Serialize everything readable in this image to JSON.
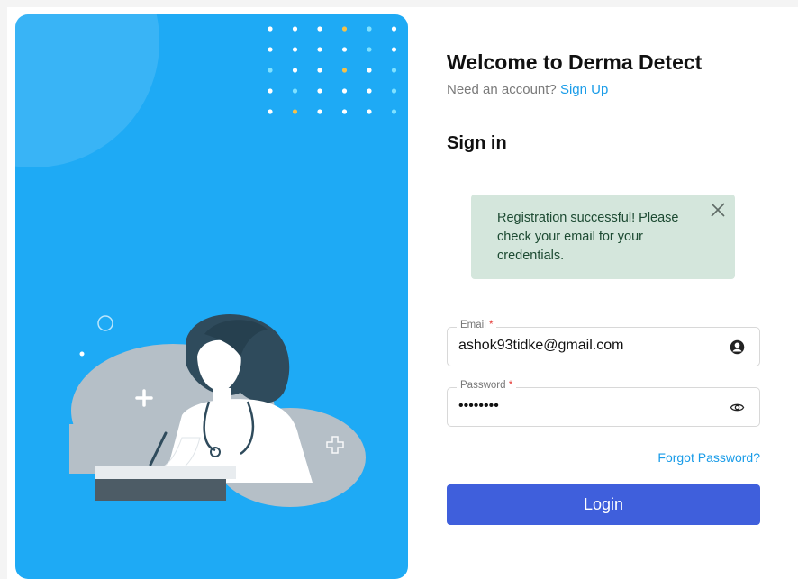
{
  "header": {
    "title": "Welcome to Derma Detect",
    "subtitle_prefix": "Need an account?",
    "signup_link": "Sign Up"
  },
  "form": {
    "heading": "Sign in",
    "email": {
      "label": "Email",
      "required_mark": "*",
      "value": "ashok93tidke@gmail.com",
      "icon": "account-circle-icon"
    },
    "password": {
      "label": "Password",
      "required_mark": "*",
      "value": "••••••••",
      "icon": "eye-icon"
    },
    "forgot_link": "Forgot Password?",
    "login_button": "Login"
  },
  "alert": {
    "message": "Registration successful! Please check your email for your credentials.",
    "close_icon": "close-icon"
  },
  "illustration": {
    "name": "doctor-writing-illustration"
  },
  "colors": {
    "hero_bg": "#1eaaf5",
    "accent_link": "#1a9ce8",
    "login_button": "#3f5fdc",
    "alert_bg": "#d4e6dc",
    "alert_text": "#1c4a32",
    "dot_highlight": "#f3c14a"
  }
}
